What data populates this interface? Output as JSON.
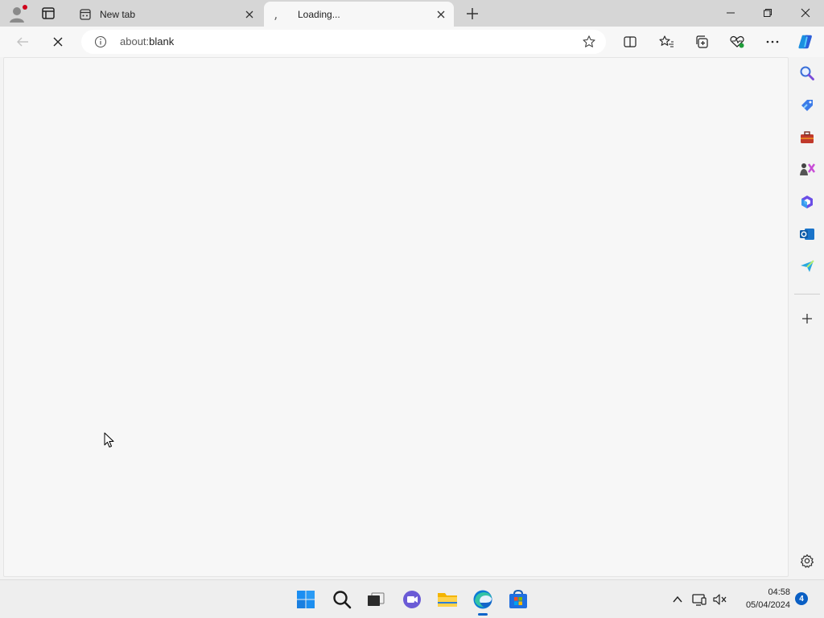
{
  "tabs": [
    {
      "title": "New tab",
      "active": false
    },
    {
      "title": "Loading...",
      "active": true
    }
  ],
  "address": {
    "prefix": "about:",
    "host": "blank"
  },
  "taskbar": {
    "apps": [
      "start-icon",
      "search-icon",
      "task-view-icon",
      "chat-icon",
      "file-explorer-icon",
      "edge-icon",
      "store-icon"
    ],
    "clock_time": "04:58",
    "clock_date": "05/04/2024",
    "notification_count": "4"
  },
  "colors": {
    "accent": "#0a63c9",
    "titlebar": "#d6d6d6",
    "content": "#f7f7f7"
  }
}
